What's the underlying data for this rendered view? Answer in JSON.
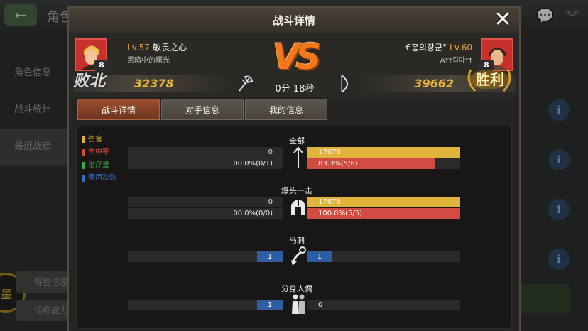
{
  "background": {
    "title": "角色",
    "sidebar": [
      "角色信息",
      "战斗统计",
      "最近战绩"
    ],
    "bottom_buttons": [
      "特性信息",
      "详细能力"
    ],
    "ring_glyph": "墨"
  },
  "modal": {
    "title": "战斗详情",
    "close_label": "✕",
    "vs_text": "VS",
    "duration": "0分 18秒",
    "left_player": {
      "level": "Lv.57",
      "name": "敬畏之心",
      "guild": "黑暗中的曙光",
      "score": "32378",
      "badge": "8",
      "result": "败北"
    },
    "right_player": {
      "level": "Lv.60",
      "name": "€홍의장군°",
      "guild": "A††길다††",
      "score": "39662",
      "badge": "8",
      "result": "胜利"
    },
    "tabs": [
      "战斗详情",
      "对手信息",
      "我的信息"
    ],
    "legend": [
      {
        "label": "伤害",
        "color": "#e0b43a"
      },
      {
        "label": "命中率",
        "color": "#d24a40"
      },
      {
        "label": "治疗量",
        "color": "#3cae48"
      },
      {
        "label": "使用次数",
        "color": "#3a6cc0"
      }
    ],
    "groups": [
      {
        "label": "全部",
        "icon": "arrow-icon",
        "damage": {
          "left": "0",
          "right": "17678",
          "right_fraction": 1.0
        },
        "hit_rate": {
          "left": "00.0%(0/1)",
          "right": "83.3%(5/6)",
          "right_fraction": 0.833
        }
      },
      {
        "label": "爆头一击",
        "icon": "helmet-icon",
        "damage": {
          "left": "0",
          "right": "17678",
          "right_fraction": 1.0
        },
        "hit_rate": {
          "left": "00.0%(0/0)",
          "right": "100.0%(5/5)",
          "right_fraction": 1.0
        }
      },
      {
        "label": "马刺",
        "icon": "spur-icon",
        "uses": {
          "left": "1",
          "right": "1"
        }
      },
      {
        "label": "分身人偶",
        "icon": "clone-icon",
        "uses": {
          "left": "1",
          "right": "0"
        }
      }
    ]
  }
}
